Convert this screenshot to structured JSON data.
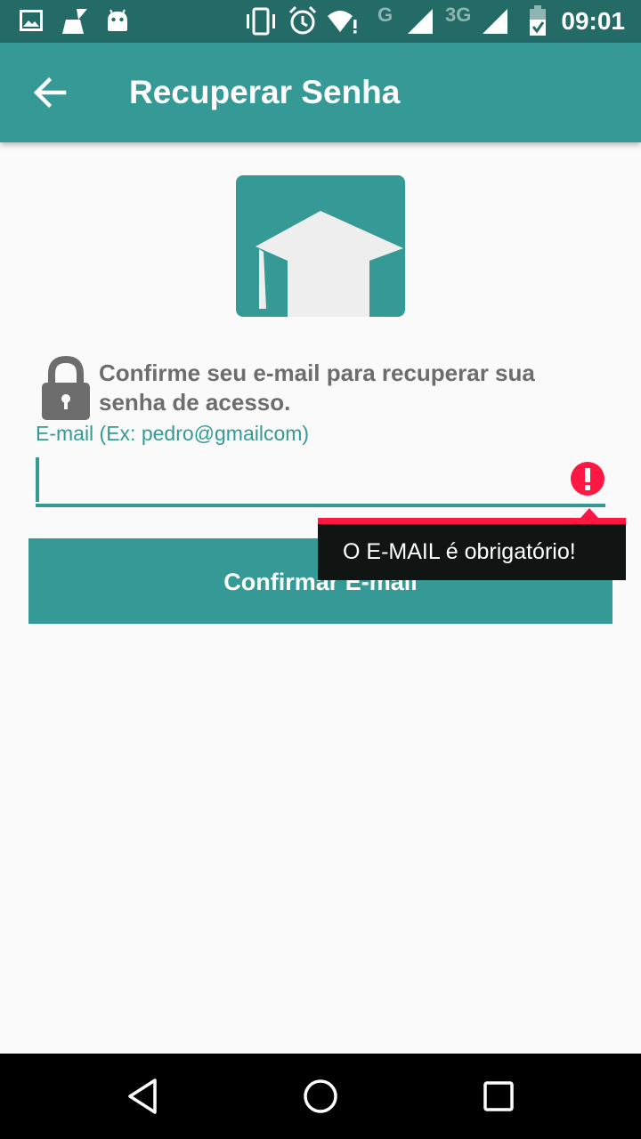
{
  "status_bar": {
    "time": "09:01",
    "network_g": "G",
    "network_3g": "3G",
    "icons": [
      "image-icon",
      "cleaner-icon",
      "android-icon",
      "vibrate-icon",
      "alarm-icon",
      "wifi-icon",
      "signal-icon",
      "signal-icon",
      "battery-icon"
    ]
  },
  "app_bar": {
    "title": "Recuperar Senha",
    "back_icon": "arrow-back-icon"
  },
  "info": {
    "lock_icon": "lock-icon",
    "text": "Confirme seu e-mail para recuperar sua senha de acesso."
  },
  "email": {
    "label": "E-mail (Ex: pedro@gmailcom)",
    "value": "",
    "error_icon": "error-icon"
  },
  "error_popup": {
    "message": "O E-MAIL é obrigatório!"
  },
  "button": {
    "label": "Confirmar E-mail"
  },
  "colors": {
    "primary": "#359a96",
    "primary_dark": "#246b68",
    "error": "#ff1744",
    "text_gray": "#6d6d6d",
    "background": "#fafafa"
  },
  "nav_bar": {
    "icons": [
      "back-triangle-icon",
      "home-circle-icon",
      "recents-square-icon"
    ]
  }
}
